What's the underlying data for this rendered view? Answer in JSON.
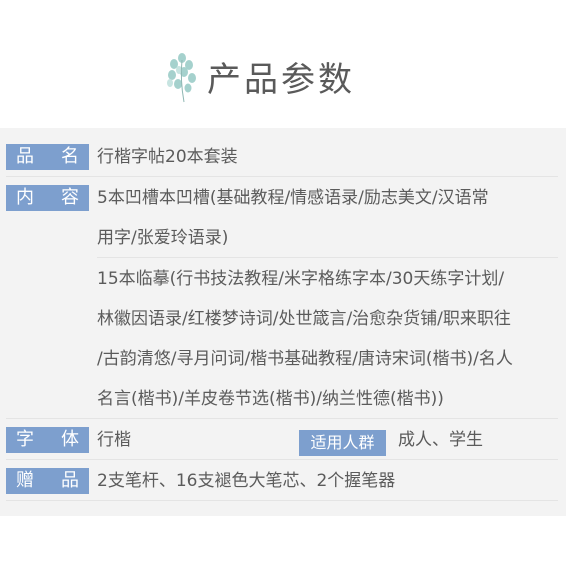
{
  "header": {
    "title": "产品参数",
    "icon": "leaf-icon",
    "colors": {
      "accent": "#7d9fce",
      "panel_bg": "#f3f3f3",
      "leaf": "#9ccdc8"
    }
  },
  "params": {
    "name_label": [
      "品",
      "名"
    ],
    "name_value": "行楷字帖20本套装",
    "content_label": [
      "内",
      "容"
    ],
    "content_lines": [
      "5本凹槽本凹槽(基础教程/情感语录/励志美文/汉语常",
      "用字/张爱玲语录)",
      "15本临摹(行书技法教程/米字格练字本/30天练字计划/",
      "林徽因语录/红楼梦诗词/处世箴言/治愈杂货铺/职来职往",
      "/古韵清悠/寻月问词/楷书基础教程/唐诗宋词(楷书)/名人",
      "名言(楷书)/羊皮卷节选(楷书)/纳兰性德(楷书))"
    ],
    "font_label": [
      "字",
      "体"
    ],
    "font_value": "行楷",
    "audience_label": "适用人群",
    "audience_value": "成人、学生",
    "gift_label": [
      "赠",
      "品"
    ],
    "gift_value": "2支笔杆、16支褪色大笔芯、2个握笔器"
  }
}
